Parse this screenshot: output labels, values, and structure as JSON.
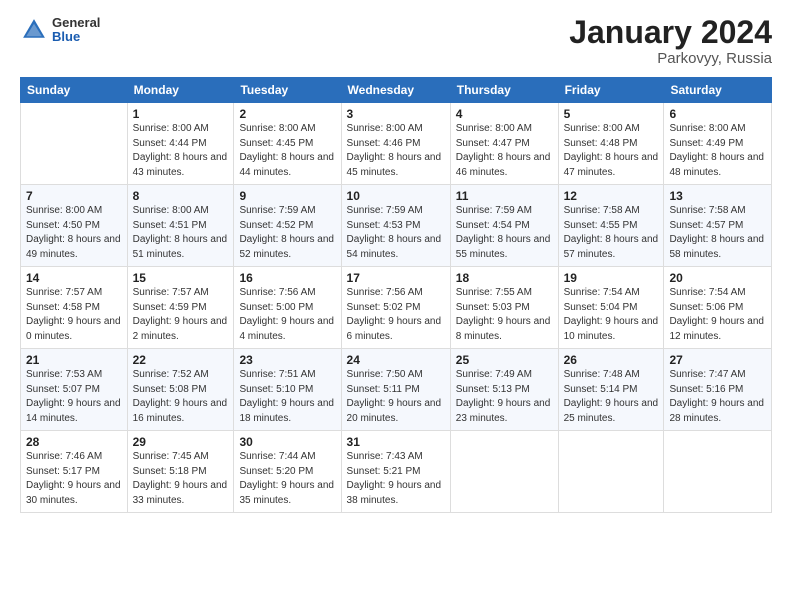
{
  "header": {
    "logo_general": "General",
    "logo_blue": "Blue",
    "title": "January 2024",
    "subtitle": "Parkovyy, Russia"
  },
  "columns": [
    "Sunday",
    "Monday",
    "Tuesday",
    "Wednesday",
    "Thursday",
    "Friday",
    "Saturday"
  ],
  "weeks": [
    [
      {
        "day": null
      },
      {
        "day": "1",
        "sunrise": "Sunrise: 8:00 AM",
        "sunset": "Sunset: 4:44 PM",
        "daylight": "Daylight: 8 hours and 43 minutes."
      },
      {
        "day": "2",
        "sunrise": "Sunrise: 8:00 AM",
        "sunset": "Sunset: 4:45 PM",
        "daylight": "Daylight: 8 hours and 44 minutes."
      },
      {
        "day": "3",
        "sunrise": "Sunrise: 8:00 AM",
        "sunset": "Sunset: 4:46 PM",
        "daylight": "Daylight: 8 hours and 45 minutes."
      },
      {
        "day": "4",
        "sunrise": "Sunrise: 8:00 AM",
        "sunset": "Sunset: 4:47 PM",
        "daylight": "Daylight: 8 hours and 46 minutes."
      },
      {
        "day": "5",
        "sunrise": "Sunrise: 8:00 AM",
        "sunset": "Sunset: 4:48 PM",
        "daylight": "Daylight: 8 hours and 47 minutes."
      },
      {
        "day": "6",
        "sunrise": "Sunrise: 8:00 AM",
        "sunset": "Sunset: 4:49 PM",
        "daylight": "Daylight: 8 hours and 48 minutes."
      }
    ],
    [
      {
        "day": "7",
        "sunrise": "Sunrise: 8:00 AM",
        "sunset": "Sunset: 4:50 PM",
        "daylight": "Daylight: 8 hours and 49 minutes."
      },
      {
        "day": "8",
        "sunrise": "Sunrise: 8:00 AM",
        "sunset": "Sunset: 4:51 PM",
        "daylight": "Daylight: 8 hours and 51 minutes."
      },
      {
        "day": "9",
        "sunrise": "Sunrise: 7:59 AM",
        "sunset": "Sunset: 4:52 PM",
        "daylight": "Daylight: 8 hours and 52 minutes."
      },
      {
        "day": "10",
        "sunrise": "Sunrise: 7:59 AM",
        "sunset": "Sunset: 4:53 PM",
        "daylight": "Daylight: 8 hours and 54 minutes."
      },
      {
        "day": "11",
        "sunrise": "Sunrise: 7:59 AM",
        "sunset": "Sunset: 4:54 PM",
        "daylight": "Daylight: 8 hours and 55 minutes."
      },
      {
        "day": "12",
        "sunrise": "Sunrise: 7:58 AM",
        "sunset": "Sunset: 4:55 PM",
        "daylight": "Daylight: 8 hours and 57 minutes."
      },
      {
        "day": "13",
        "sunrise": "Sunrise: 7:58 AM",
        "sunset": "Sunset: 4:57 PM",
        "daylight": "Daylight: 8 hours and 58 minutes."
      }
    ],
    [
      {
        "day": "14",
        "sunrise": "Sunrise: 7:57 AM",
        "sunset": "Sunset: 4:58 PM",
        "daylight": "Daylight: 9 hours and 0 minutes."
      },
      {
        "day": "15",
        "sunrise": "Sunrise: 7:57 AM",
        "sunset": "Sunset: 4:59 PM",
        "daylight": "Daylight: 9 hours and 2 minutes."
      },
      {
        "day": "16",
        "sunrise": "Sunrise: 7:56 AM",
        "sunset": "Sunset: 5:00 PM",
        "daylight": "Daylight: 9 hours and 4 minutes."
      },
      {
        "day": "17",
        "sunrise": "Sunrise: 7:56 AM",
        "sunset": "Sunset: 5:02 PM",
        "daylight": "Daylight: 9 hours and 6 minutes."
      },
      {
        "day": "18",
        "sunrise": "Sunrise: 7:55 AM",
        "sunset": "Sunset: 5:03 PM",
        "daylight": "Daylight: 9 hours and 8 minutes."
      },
      {
        "day": "19",
        "sunrise": "Sunrise: 7:54 AM",
        "sunset": "Sunset: 5:04 PM",
        "daylight": "Daylight: 9 hours and 10 minutes."
      },
      {
        "day": "20",
        "sunrise": "Sunrise: 7:54 AM",
        "sunset": "Sunset: 5:06 PM",
        "daylight": "Daylight: 9 hours and 12 minutes."
      }
    ],
    [
      {
        "day": "21",
        "sunrise": "Sunrise: 7:53 AM",
        "sunset": "Sunset: 5:07 PM",
        "daylight": "Daylight: 9 hours and 14 minutes."
      },
      {
        "day": "22",
        "sunrise": "Sunrise: 7:52 AM",
        "sunset": "Sunset: 5:08 PM",
        "daylight": "Daylight: 9 hours and 16 minutes."
      },
      {
        "day": "23",
        "sunrise": "Sunrise: 7:51 AM",
        "sunset": "Sunset: 5:10 PM",
        "daylight": "Daylight: 9 hours and 18 minutes."
      },
      {
        "day": "24",
        "sunrise": "Sunrise: 7:50 AM",
        "sunset": "Sunset: 5:11 PM",
        "daylight": "Daylight: 9 hours and 20 minutes."
      },
      {
        "day": "25",
        "sunrise": "Sunrise: 7:49 AM",
        "sunset": "Sunset: 5:13 PM",
        "daylight": "Daylight: 9 hours and 23 minutes."
      },
      {
        "day": "26",
        "sunrise": "Sunrise: 7:48 AM",
        "sunset": "Sunset: 5:14 PM",
        "daylight": "Daylight: 9 hours and 25 minutes."
      },
      {
        "day": "27",
        "sunrise": "Sunrise: 7:47 AM",
        "sunset": "Sunset: 5:16 PM",
        "daylight": "Daylight: 9 hours and 28 minutes."
      }
    ],
    [
      {
        "day": "28",
        "sunrise": "Sunrise: 7:46 AM",
        "sunset": "Sunset: 5:17 PM",
        "daylight": "Daylight: 9 hours and 30 minutes."
      },
      {
        "day": "29",
        "sunrise": "Sunrise: 7:45 AM",
        "sunset": "Sunset: 5:18 PM",
        "daylight": "Daylight: 9 hours and 33 minutes."
      },
      {
        "day": "30",
        "sunrise": "Sunrise: 7:44 AM",
        "sunset": "Sunset: 5:20 PM",
        "daylight": "Daylight: 9 hours and 35 minutes."
      },
      {
        "day": "31",
        "sunrise": "Sunrise: 7:43 AM",
        "sunset": "Sunset: 5:21 PM",
        "daylight": "Daylight: 9 hours and 38 minutes."
      },
      {
        "day": null
      },
      {
        "day": null
      },
      {
        "day": null
      }
    ]
  ]
}
